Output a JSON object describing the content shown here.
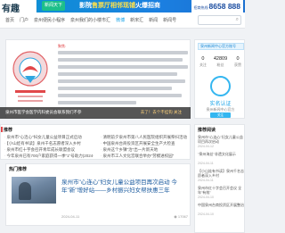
{
  "logo": {
    "text": "有趣"
  },
  "banner": {
    "badge": "新闻天下",
    "text_pre": "影院",
    "text_hl": "售票厅相邻现铺",
    "text_post": "火爆招商",
    "phone_label": "招商热线",
    "phone": "8658 888"
  },
  "nav": {
    "items": [
      {
        "label": "首页"
      },
      {
        "label": "门户"
      },
      {
        "label": "泉州便民小程序"
      },
      {
        "label": "泉州我们的小楼市汇"
      },
      {
        "label": "微博",
        "active": true
      },
      {
        "label": "新宋汇"
      },
      {
        "label": "新闻"
      },
      {
        "label": "新闻号"
      }
    ],
    "search_placeholder": ""
  },
  "card": {
    "tag": "聚焦:",
    "caption_left": "泉州市医学会医学内科委员会联系我们不参",
    "caption_right": "去了！去个不挂钩  关注"
  },
  "side": {
    "top_text": "泉州新闻中心官方账号",
    "stats": [
      {
        "num": "0",
        "label": "关注"
      },
      {
        "num": "42809",
        "label": "粉丝"
      },
      {
        "num": "0",
        "label": "获赞"
      }
    ],
    "verify_title": "实名认证",
    "verify_sub": "泉州新闻中心官方",
    "verify_btn": "关注"
  },
  "news_block": {
    "title": "推荐",
    "left_items": [
      "泉州市\"心连心\"妇女儿童公益项目正式启动",
      "【小山娃有书读】泉州千名志愿者深入乡村",
      "泉州市红十字会召开青年成长联盟会议",
      "今年泉州已有700户家庭获得一季\"1\"号助力(2024-04-15)"
    ],
    "right_items": [
      "清明前夕泉州市第八人民医院组织开展祭扫活动",
      "中国泉州台商投资区开展安全生产大检查",
      "泉州这个乡镇\"治\"出一片新天地",
      "泉州市工人文化宫联合举办\"劳模进校园\""
    ]
  },
  "article": {
    "head": "热门推荐",
    "title": "泉州市\"心连心\"妇女儿童公益项目再次启动 今年\"新\"增好站——乡村振兴妇女帮扶惠三年",
    "date": "2024-04-11",
    "views": "17067"
  },
  "right_panel": {
    "title": "推荐阅读",
    "items": [
      {
        "text": "泉州市\"心连心\"妇女儿童公益项目再次启动",
        "date": "2024-04-12"
      },
      {
        "text": "\"泉州海丝\"非遗文化展示",
        "date": "2024-04-11"
      },
      {
        "text": "【小山娃有书读】泉州千名志愿者深入乡村",
        "date": "2024-04-11"
      },
      {
        "text": "泉州市红十字会召开会议 全年\"有效\"",
        "date": "2024-04-10"
      },
      {
        "text": "中国泉州台商投资区开展整治",
        "date": "2024-04-10"
      }
    ]
  }
}
